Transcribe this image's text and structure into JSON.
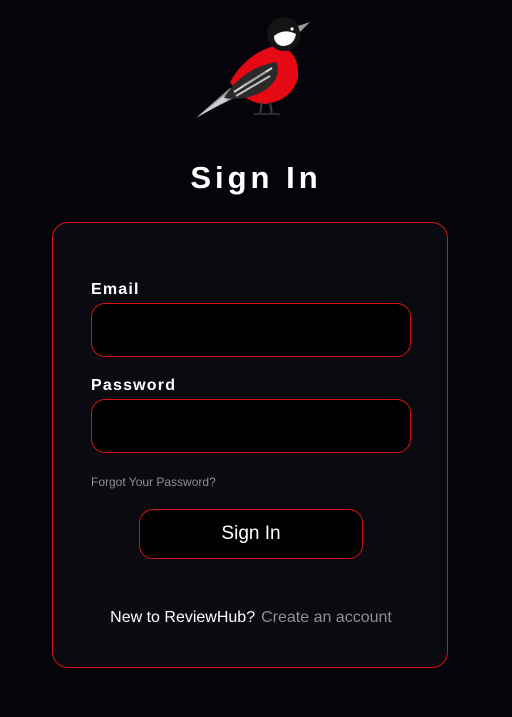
{
  "logo": {
    "icon": "bird-logo-icon",
    "colors": {
      "body": "#e50914",
      "head": "#111111",
      "cheek": "#ffffff",
      "wing": "#8a8a8a"
    }
  },
  "title": "Sign In",
  "form": {
    "email_label": "Email",
    "email_value": "",
    "email_placeholder": "",
    "password_label": "Password",
    "password_value": "",
    "password_placeholder": "",
    "forgot_link": "Forgot Your Password?",
    "submit_label": "Sign In"
  },
  "footer": {
    "question": "New to ReviewHub?",
    "create_link": "Create an account"
  },
  "colors": {
    "accent": "#d31414",
    "background": "#04040a",
    "card": "#0b0a10",
    "muted": "#8e8e96"
  }
}
